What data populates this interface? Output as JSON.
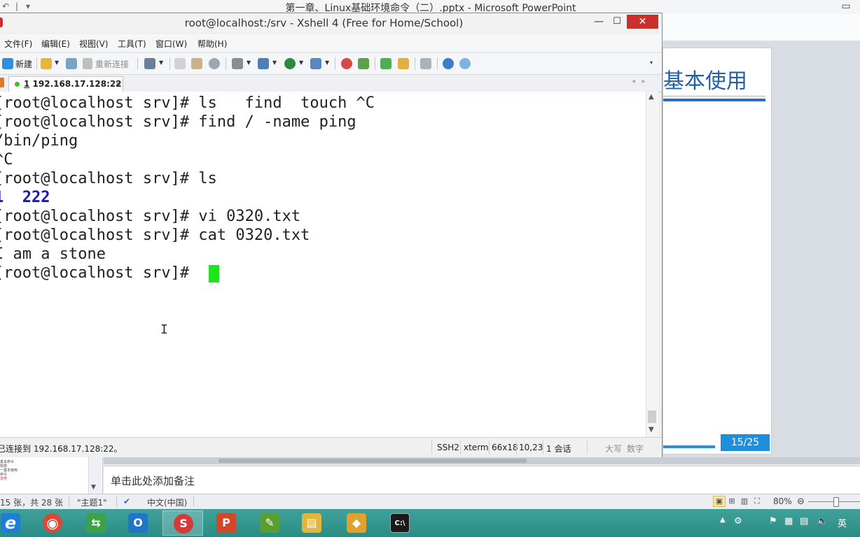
{
  "ppt": {
    "qat": [
      "↶",
      "|",
      "▾"
    ],
    "window_title": "第一章、Linux基础环境命令（二）.pptx - Microsoft PowerPoint",
    "slide_title": "基本使用",
    "slide_number": "15/25",
    "notes_placeholder": "单击此处添加备注",
    "thumbnail_lines": [
      "基本命令",
      "权限",
      "一基本使用",
      "命令",
      "文件"
    ],
    "status": {
      "slide_count": "15 张，共 28 张",
      "theme": "\"主题1\"",
      "language": "中文(中国)",
      "zoom": "80%"
    }
  },
  "xshell": {
    "title": "root@localhost:/srv - Xshell 4 (Free for Home/School)",
    "menu": [
      "文件(F)",
      "编辑(E)",
      "视图(V)",
      "工具(T)",
      "窗口(W)",
      "帮助(H)"
    ],
    "toolbar": {
      "new_label": "新建",
      "reconnect_label": "重新连接"
    },
    "tab": {
      "index": "1",
      "label": "192.168.17.128:22",
      "close": "×"
    },
    "terminal": {
      "lines": [
        "[root@localhost srv]# ls   find  touch ^C",
        "[root@localhost srv]# find / -name ping",
        "/bin/ping",
        "^C",
        "[root@localhost srv]# ls",
        "1  222",
        "[root@localhost srv]# vi 0320.txt",
        "[root@localhost srv]# cat 0320.txt",
        "I am a stone",
        "[root@localhost srv]# "
      ]
    },
    "status": {
      "connection": "已连接到 192.168.17.128:22。",
      "protocol": "SSH2",
      "term_type": "xterm",
      "size": "66x18",
      "cursor_pos": "10,23",
      "sessions": "1 会话",
      "caps": "大写",
      "num": "数字"
    }
  },
  "taskbar": {
    "apps": [
      {
        "name": "ie",
        "glyph": "e",
        "color": "#1b7fd6"
      },
      {
        "name": "chrome",
        "glyph": "◉",
        "color": "#d9493a"
      },
      {
        "name": "remote",
        "glyph": "⇆",
        "color": "#3aa346"
      },
      {
        "name": "outlook",
        "glyph": "O",
        "color": "#1d76c9"
      },
      {
        "name": "xshell",
        "glyph": "S",
        "color": "#d53a3a"
      },
      {
        "name": "powerpoint",
        "glyph": "P",
        "color": "#d24726"
      },
      {
        "name": "notepad",
        "glyph": "✎",
        "color": "#5a9e2f"
      },
      {
        "name": "explorer",
        "glyph": "▤",
        "color": "#e3b53c"
      },
      {
        "name": "gadget",
        "glyph": "◆",
        "color": "#e0a22e"
      },
      {
        "name": "cmd",
        "glyph": "C:\\",
        "color": "#1a1a1a"
      }
    ],
    "tray_ime": "英"
  },
  "colors": {
    "cursor": "#1ee41e",
    "dir_listing": "#1a1aa6",
    "close_button": "#c9302c",
    "slide_accent": "#1f5fa8"
  }
}
